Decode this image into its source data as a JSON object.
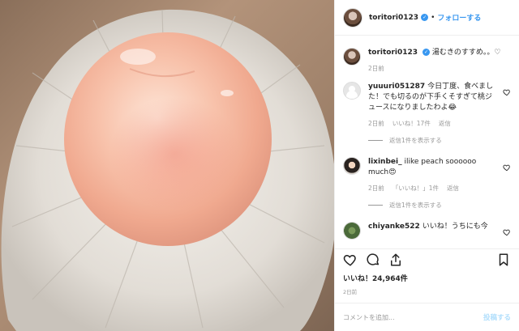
{
  "post": {
    "username": "toritori0123",
    "follow_label": "フォローする",
    "dot": "•",
    "caption": "湯むきのすすめ。。♡",
    "caption_time": "2日前"
  },
  "comments": [
    {
      "username": "yuuuri051287",
      "text": "今日丁度、食べました！でも切るのが下手くそすぎて桃ジュースになりましたわよ😂",
      "time": "2日前",
      "likes": "いいね！17件",
      "reply": "返信",
      "view_replies": "返信1件を表示する"
    },
    {
      "username": "lixinbei_",
      "text": "ilike peach soooooo much😍",
      "time": "2日前",
      "likes": "「いいね！」1件",
      "reply": "返信",
      "view_replies": "返信1件を表示する"
    },
    {
      "username": "chiyanke522",
      "text": "いいね！うちにも今",
      "time": "",
      "likes": "",
      "reply": "",
      "view_replies": ""
    }
  ],
  "footer": {
    "likes_count": "いいね！24,964件",
    "time": "2日前",
    "comment_placeholder": "コメントを追加...",
    "post_label": "投稿する"
  },
  "icons": {
    "like": "heart-icon",
    "comment": "comment-icon",
    "share": "share-icon",
    "save": "bookmark-icon"
  },
  "colors": {
    "link_blue": "#3897f0",
    "post_disabled": "#b2dffc",
    "meta_gray": "#999999"
  }
}
